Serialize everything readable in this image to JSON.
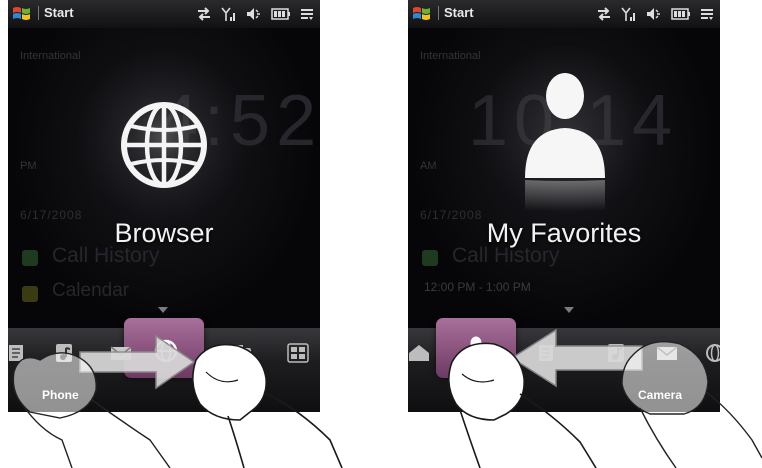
{
  "panels": [
    {
      "status_title": "Start",
      "background": {
        "location": "International",
        "clock": "4:52",
        "ampm": "PM",
        "date": "6/17/2008",
        "history": "Call History",
        "calendar": "Calendar",
        "time_range": ""
      },
      "focus_label": "Browser",
      "focus_icon": "globe-icon",
      "tab_label": "Phone",
      "gesture": "swipe-right"
    },
    {
      "status_title": "Start",
      "background": {
        "location": "International",
        "clock": "10:14",
        "ampm": "AM",
        "date": "6/17/2008",
        "history": "Call History",
        "calendar": "",
        "time_range": "12:00 PM - 1:00 PM"
      },
      "focus_label": "My Favorites",
      "focus_icon": "person-icon",
      "tab_label": "Camera",
      "gesture": "swipe-left"
    }
  ],
  "colors": {
    "accent": "#8a4f7d",
    "screen_bg": "#0b0b0d",
    "statusbar": "#1c1c1f",
    "finger_fill": "#ffffff",
    "arrow_fill": "#d9d9d9"
  }
}
